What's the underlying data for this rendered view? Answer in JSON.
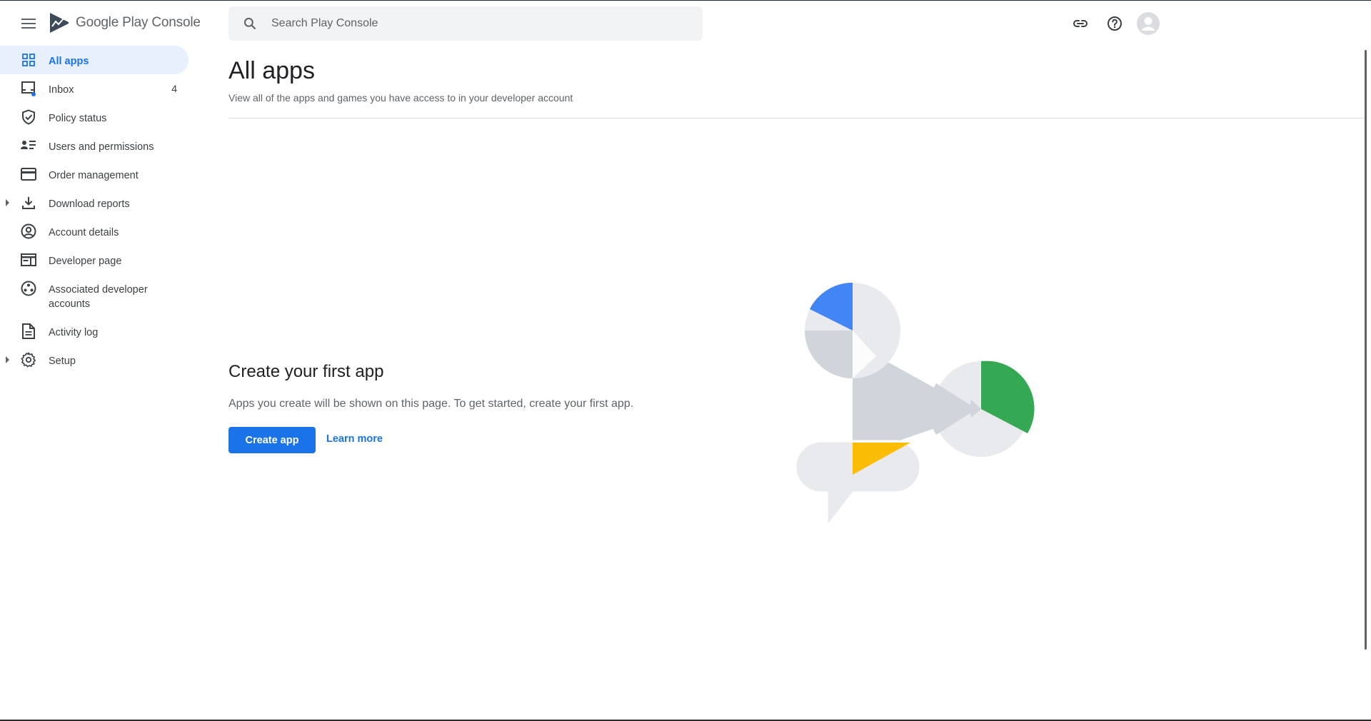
{
  "header": {
    "logo_text_google_play": "Google Play",
    "logo_text_console": "Console",
    "search_placeholder": "Search Play Console"
  },
  "sidebar": {
    "items": [
      {
        "label": "All apps",
        "icon": "grid-icon",
        "active": true
      },
      {
        "label": "Inbox",
        "icon": "inbox-icon",
        "count": "4"
      },
      {
        "label": "Policy status",
        "icon": "shield-check-icon"
      },
      {
        "label": "Users and permissions",
        "icon": "users-list-icon"
      },
      {
        "label": "Order management",
        "icon": "credit-card-icon"
      },
      {
        "label": "Download reports",
        "icon": "download-icon",
        "expandable": true
      },
      {
        "label": "Account details",
        "icon": "account-circle-icon"
      },
      {
        "label": "Developer page",
        "icon": "web-page-icon"
      },
      {
        "label": "Associated developer accounts",
        "icon": "linked-accounts-icon"
      },
      {
        "label": "Activity log",
        "icon": "document-icon"
      },
      {
        "label": "Setup",
        "icon": "gear-icon",
        "expandable": true
      }
    ]
  },
  "main": {
    "title": "All apps",
    "subtitle": "View all of the apps and games you have access to in your developer account",
    "empty_state": {
      "title": "Create your first app",
      "description": "Apps you create will be shown on this page. To get started, create your first app.",
      "create_button": "Create app",
      "learn_more": "Learn more"
    }
  },
  "colors": {
    "accent": "#1a73e8",
    "active_bg": "#e8f0fe",
    "illustration_blue": "#4285f4",
    "illustration_green": "#34a853",
    "illustration_yellow": "#fbbc04",
    "illustration_gray": "#cfd5da",
    "illustration_light": "#e8eaed"
  }
}
